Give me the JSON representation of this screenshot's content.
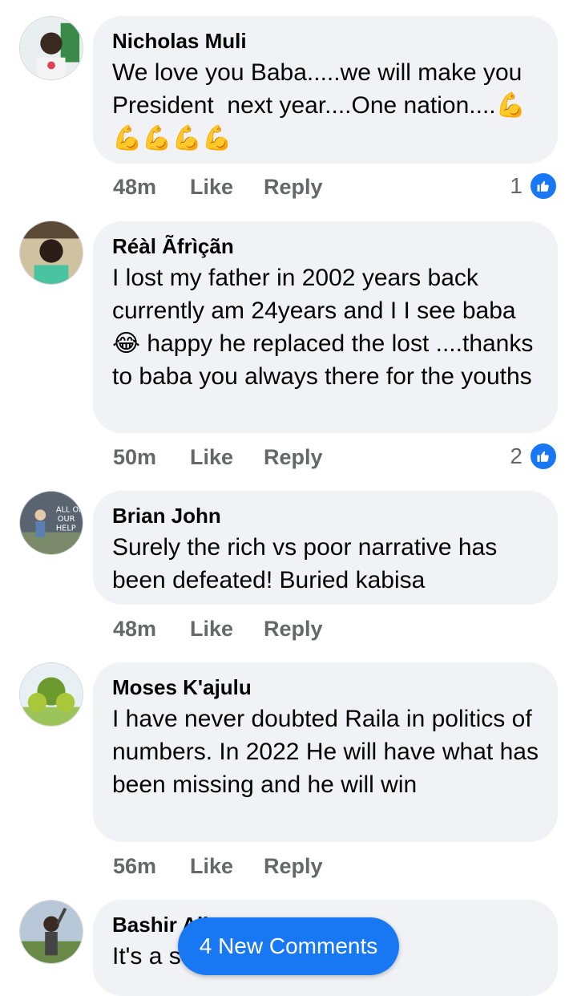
{
  "comments": [
    {
      "author": "Nicholas Muli",
      "text": "We love you Baba.....we will make you President  next year....One nation....💪💪💪💪💪",
      "time": "48m",
      "like": "Like",
      "reply": "Reply",
      "reactions": "1"
    },
    {
      "author": "Réàl Ãfrìçãn",
      "text": "I lost my father in 2002 years back currently am 24years and I I see baba 😂 happy he replaced the lost ....thanks to baba you always there for the youths",
      "time": "50m",
      "like": "Like",
      "reply": "Reply",
      "reactions": "2"
    },
    {
      "author": "Brian John",
      "text": "Surely the rich vs poor narrative has been defeated! Buried kabisa",
      "time": "48m",
      "like": "Like",
      "reply": "Reply"
    },
    {
      "author": "Moses K'ajulu",
      "text": "I have never doubted Raila in politics of numbers. In 2022 He will have what has been missing and he will win",
      "time": "56m",
      "like": "Like",
      "reply": "Reply"
    },
    {
      "author": "Bashir Ali",
      "text": "It's a s"
    }
  ],
  "new_comments_button": "4 New Comments",
  "colors": {
    "accent": "#1877f2",
    "bubble": "#f0f2f5",
    "meta": "#65676b"
  }
}
